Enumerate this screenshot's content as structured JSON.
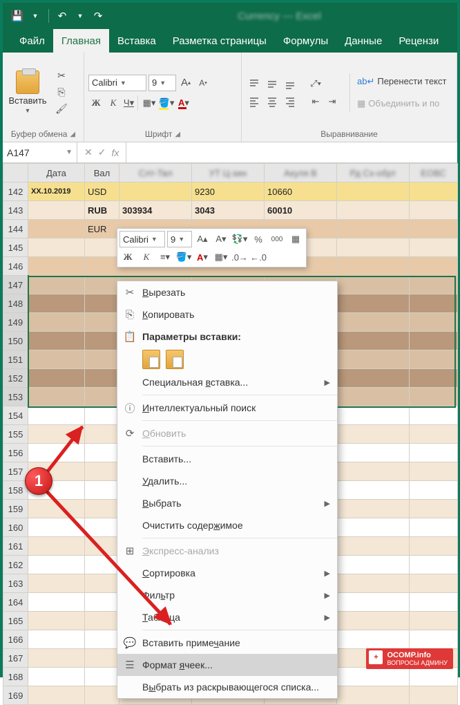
{
  "titlebar": {
    "doc_name": "Currency — Excel"
  },
  "tabs": [
    "Файл",
    "Главная",
    "Вставка",
    "Разметка страницы",
    "Формулы",
    "Данные",
    "Рецензи"
  ],
  "active_tab": 1,
  "ribbon": {
    "clipboard": {
      "paste": "Вставить",
      "group": "Буфер обмена"
    },
    "font": {
      "name": "Calibri",
      "size": "9",
      "group": "Шрифт",
      "bold": "Ж",
      "italic": "К",
      "under": "Ч"
    },
    "align": {
      "group": "Выравнивание",
      "wrap": "Перенести текст",
      "merge": "Объединить и по"
    }
  },
  "namebox": "A147",
  "headers": [
    "Дата",
    "Вал"
  ],
  "rows": [
    {
      "n": "142",
      "d": "XX.10.2019",
      "v": "USD",
      "c3": "",
      "c4": "9230",
      "c5": "10660",
      "c6": "",
      "cls": "yellow"
    },
    {
      "n": "143",
      "d": "",
      "v": "RUB",
      "c3": "303934",
      "c4": "3043",
      "c5": "60010",
      "c6": "",
      "cls": "band-light",
      "boldrow": true
    },
    {
      "n": "144",
      "d": "",
      "v": "EUR",
      "c3": "",
      "c4": "",
      "c5": "",
      "c6": "",
      "cls": "band-dark"
    },
    {
      "n": "145",
      "cls": "band-light"
    },
    {
      "n": "146",
      "cls": "band-dark"
    },
    {
      "n": "147",
      "cls": "band-light",
      "sel": true,
      "lr": true
    },
    {
      "n": "148",
      "cls": "band-dark",
      "sel": true
    },
    {
      "n": "149",
      "cls": "band-light",
      "sel": true,
      "lr": true
    },
    {
      "n": "150",
      "cls": "band-dark",
      "sel": true
    },
    {
      "n": "151",
      "cls": "band-light",
      "sel": true,
      "lr": true
    },
    {
      "n": "152",
      "cls": "band-dark",
      "sel": true
    },
    {
      "n": "153",
      "cls": "band-light",
      "sel": true,
      "lr": true
    },
    {
      "n": "154",
      "cls": "plain"
    },
    {
      "n": "155",
      "cls": "band-light"
    },
    {
      "n": "156",
      "cls": "plain"
    },
    {
      "n": "157",
      "cls": "band-light"
    },
    {
      "n": "158",
      "cls": "plain"
    },
    {
      "n": "159",
      "cls": "band-light"
    },
    {
      "n": "160",
      "cls": "plain"
    },
    {
      "n": "161",
      "cls": "band-light"
    },
    {
      "n": "162",
      "cls": "plain"
    },
    {
      "n": "163",
      "cls": "band-light"
    },
    {
      "n": "164",
      "cls": "plain"
    },
    {
      "n": "165",
      "cls": "band-light"
    },
    {
      "n": "166",
      "cls": "plain"
    },
    {
      "n": "167",
      "cls": "band-light"
    },
    {
      "n": "168",
      "cls": "plain"
    },
    {
      "n": "169",
      "cls": "band-light"
    }
  ],
  "minibar": {
    "font": "Calibri",
    "size": "9",
    "bold": "Ж",
    "italic": "К",
    "a_big": "A",
    "a_small": "A",
    "pct": "%",
    "zeros": "000"
  },
  "ctx": {
    "cut": "Вырезать",
    "copy": "Копировать",
    "paste_opts": "Параметры вставки:",
    "special_paste": "Специальная вставка...",
    "smart_lookup": "Интеллектуальный поиск",
    "refresh": "Обновить",
    "insert": "Вставить...",
    "delete": "Удалить...",
    "select": "Выбрать",
    "clear": "Очистить содержимое",
    "quick": "Экспресс-анализ",
    "sort": "Сортировка",
    "filter": "Фильтр",
    "table": "Таблица",
    "comment": "Вставить примечание",
    "format": "Формат ячеек...",
    "dropdown": "Выбрать из раскрывающегося списка..."
  },
  "badge": "1",
  "watermark": {
    "line1": "OCOMP.info",
    "line2": "ВОПРОСЫ АДМИНУ"
  }
}
